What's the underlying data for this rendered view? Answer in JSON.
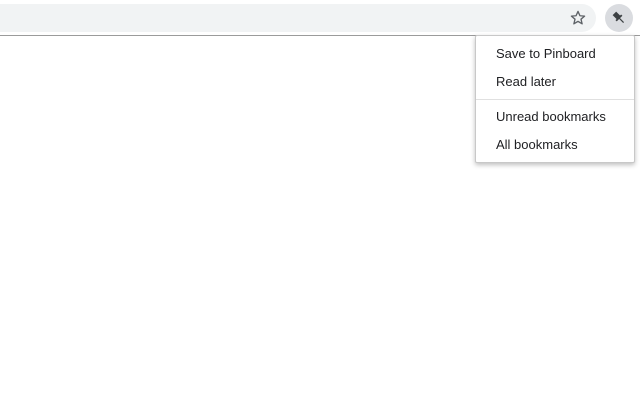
{
  "toolbar": {
    "address_value": "",
    "star_icon": "star-outline-icon",
    "extension_icon": "pushpin-icon"
  },
  "menu": {
    "items": [
      {
        "label": "Save to Pinboard"
      },
      {
        "label": "Read later"
      },
      {
        "label": "Unread bookmarks"
      },
      {
        "label": "All bookmarks"
      }
    ]
  },
  "colors": {
    "toolbar_bg": "#ffffff",
    "omnibox_bg": "#f1f3f4",
    "extension_button_bg": "#dadce0",
    "menu_text": "#202124",
    "icon": "#5f6368"
  }
}
